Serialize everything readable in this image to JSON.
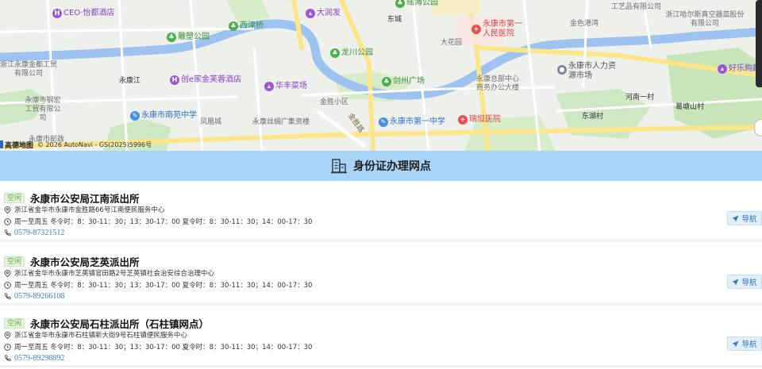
{
  "map": {
    "attribution_logo": "高德地图",
    "attribution_text": "© 2026 AutoNavi - GS(2025)5996号",
    "pois": [
      {
        "label": "CEO·怡都酒店",
        "color": "purple",
        "icon": "hotel-icon"
      },
      {
        "label": "雕塑公园",
        "color": "green",
        "icon": "park-icon"
      },
      {
        "label": "西津桥",
        "color": "green",
        "icon": "park-icon"
      },
      {
        "label": "大润发",
        "color": "purple",
        "icon": "shopping-icon"
      },
      {
        "label": "龙川公园",
        "color": "green",
        "icon": "park-icon"
      },
      {
        "label": "剑州广场",
        "color": "green",
        "icon": "park-icon"
      },
      {
        "label": "华丰菜场",
        "color": "purple",
        "icon": "shopping-icon"
      },
      {
        "label": "创e家金芙蓉酒店",
        "color": "purple",
        "icon": "hotel-icon"
      },
      {
        "label": "永康市南苑中学",
        "color": "blue",
        "icon": "school-icon"
      },
      {
        "label": "永康市第一中学",
        "color": "blue",
        "icon": "school-icon"
      },
      {
        "label": "瑞恒医院",
        "color": "red",
        "icon": "hospital-icon"
      },
      {
        "label": "永康市第一人民医院",
        "color": "red",
        "icon": "hospital-icon"
      },
      {
        "label": "永康市人力资源市场",
        "color": "blue",
        "icon": "office-icon"
      },
      {
        "label": "好乐购超",
        "color": "purple",
        "icon": "shopping-icon"
      },
      {
        "label": "瑶海公园",
        "color": "green",
        "icon": "park-icon"
      }
    ],
    "labels": [
      "东城",
      "大花园",
      "金色港湾",
      "工艺品有限公司",
      "浙江哈尔斯真空器皿股份有限公司",
      "浙江永康金都工贸有限公司",
      "永康江",
      "永康市钢宏工贸有限公司",
      "凤凰城",
      "永康丝绸广集资楼",
      "金胜小区",
      "金胜路",
      "永康总部中心商务办公大楼",
      "河南一村",
      "葛塘山村",
      "东湖村",
      "永康市邮政"
    ]
  },
  "header": {
    "title": "身份证办理网点"
  },
  "offices": [
    {
      "status": "空闲",
      "name": "永康市公安局江南派出所",
      "address": "浙江省金华市永康市金胜路66号江南便民服务中心",
      "hours": "周一至周五 冬令时：8：30-11：30；13：30-17：00 夏令时：8：30-11：30；14：00-17：30",
      "phone": "0579-87321512",
      "nav_label": "导航"
    },
    {
      "status": "空闲",
      "name": "永康市公安局芝英派出所",
      "address": "浙江省金华市永康市芝英镇官田路2号芝英镇社会治安综合治理中心",
      "hours": "周一至周五 冬令时：8：30-11：30；13：30-17：00 夏令时：8：30-11：30；14：00-17：30",
      "phone": "0579-89266108",
      "nav_label": "导航"
    },
    {
      "status": "空闲",
      "name": "永康市公安局石柱派出所（石柱镇网点）",
      "address": "浙江省金华市永康市石柱镇新大街9号石柱镇便民服务中心",
      "hours": "周一至周五 冬令时：8：30-11：30；13：30-17：00 夏令时：8：30-11：30；14：00-17：30",
      "phone": "0579-89298892",
      "nav_label": "导航"
    }
  ],
  "colors": {
    "header_bg": "#a8d4f7",
    "status_green": "#5fae3a",
    "link_blue": "#3a7bd5",
    "river": "#9fc3f0",
    "park": "#cfe8c4",
    "road_major": "#fde68a"
  }
}
